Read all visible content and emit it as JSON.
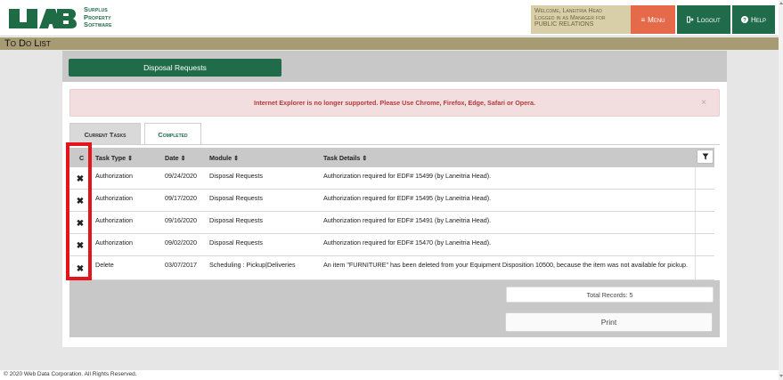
{
  "header": {
    "brand_line1": "Surplus",
    "brand_line2": "Property",
    "brand_line3": "Software",
    "welcome_line1": "Welcome, Laneitria Head",
    "welcome_line2": "Logged in as Manager for",
    "welcome_line3": "PUBLIC RELATIONS",
    "menu_label": "Menu",
    "logout_label": "Logout",
    "help_label": "Help"
  },
  "page": {
    "title": "To Do List",
    "disposal_button": "Disposal Requests",
    "alert_text": "Internet Explorer is no longer supported. Please Use Chrome, Firefox, Edge, Safari or Opera.",
    "alert_close": "×"
  },
  "tabs": [
    {
      "label": "Current Tasks",
      "active": true
    },
    {
      "label": "Completed",
      "active": false
    }
  ],
  "table": {
    "headers": [
      "C",
      "Task Type ⇕",
      "Date ⇕",
      "Module ⇕",
      "Task Details ⇕"
    ],
    "rows": [
      {
        "task_type": "Authorization",
        "date": "09/24/2020",
        "module": "Disposal Requests",
        "details": "Authorization required for EDF# 15499 (by Laneitria Head)."
      },
      {
        "task_type": "Authorization",
        "date": "09/17/2020",
        "module": "Disposal Requests",
        "details": "Authorization required for EDF# 15495 (by Laneitria Head)."
      },
      {
        "task_type": "Authorization",
        "date": "09/16/2020",
        "module": "Disposal Requests",
        "details": "Authorization required for EDF# 15491 (by Laneitria Head)."
      },
      {
        "task_type": "Authorization",
        "date": "09/02/2020",
        "module": "Disposal Requests",
        "details": "Authorization required for EDF# 15470 (by Laneitria Head)."
      },
      {
        "task_type": "Delete",
        "date": "03/07/2017",
        "module": "Scheduling : Pickup|Deliveries",
        "details": "An item \"FURNITURE\" has been deleted from your Equipment Disposition 10500, because the item was not available for pickup."
      }
    ],
    "total_records": "Total Records: 5",
    "print_label": "Print"
  },
  "footer": {
    "copyright": "© 2020 Web Data Corporation. All Rights Reserved."
  },
  "colors": {
    "brand_green": "#1f6b4a",
    "menu_orange": "#e56a4a",
    "title_tan": "#a69b72",
    "alert_red": "#b13b3b",
    "highlight_red": "#e4141a"
  },
  "icons": {
    "menu": "hamburger-icon",
    "logout": "sign-out-icon",
    "help": "question-circle-icon",
    "filter": "filter-icon",
    "remove": "times-icon"
  }
}
